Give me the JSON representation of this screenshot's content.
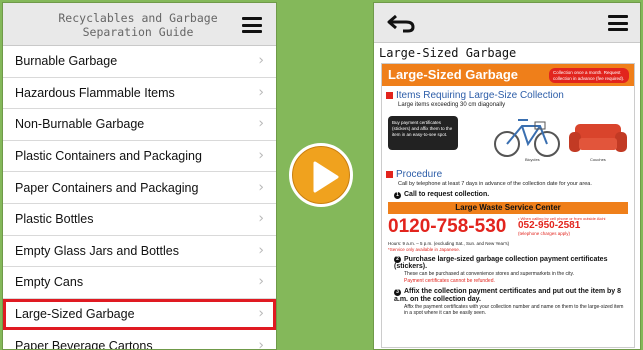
{
  "left": {
    "header_title": "Recyclables and Garbage\nSeparation Guide",
    "menu_items": [
      "Burnable Garbage",
      "Hazardous Flammable Items",
      "Non-Burnable Garbage",
      "Plastic Containers and Packaging",
      "Paper Containers and Packaging",
      "Plastic Bottles",
      "Empty Glass Jars and Bottles",
      "Empty Cans",
      "Large-Sized Garbage",
      "Paper Beverage Cartons"
    ],
    "selected_index": 8,
    "chevron": "›"
  },
  "right": {
    "page_title": "Large-Sized Garbage",
    "doc": {
      "banner_title": "Large-Sized Garbage",
      "banner_badge": "Collection once a month. Request collection in advance (fee required).",
      "items_heading": "Items Requiring Large-Size Collection",
      "items_sub": "Large items exceeding 30 cm diagonally",
      "tip": "Buy payment certificates (stickers) and affix them to the item in an easy-to-see spot.",
      "caption_bicycles": "Bicycles",
      "caption_couches": "Couches",
      "procedure_heading": "Procedure",
      "procedure_sub": "Call by telephone at least 7 days in advance of the collection date for your area.",
      "step1": "Call to request collection.",
      "center_name": "Large Waste Service Center",
      "phone_main": "0120-758-530",
      "phone_alt_note": "• When calling by cell phone or from outside Aichi",
      "phone_alt": "052-950-2581",
      "phone_alt_sub": "(telephone charges apply)",
      "hours": "Hours: 9 a.m. – 5 p.m. (excluding Sat., Sun. and New Year's)",
      "hours_note": "*Service only available in Japanese.",
      "step2": "Purchase large-sized garbage collection payment certificates (stickers).",
      "step2_text": "These can be purchased at convenience stores and supermarkets in the city.",
      "step2_note": "Payment certificates cannot be refunded.",
      "step3": "Affix the collection payment certificates and put out the item by 8 a.m. on the collection day.",
      "step3_text": "Affix the payment certificates with your collection number and name on them to the large-sized item in a spot where it can be easily seen."
    }
  },
  "colors": {
    "background": "#84b85a",
    "highlight": "#e01a22",
    "orange": "#ef7f1a",
    "play": "#f0a21e"
  }
}
